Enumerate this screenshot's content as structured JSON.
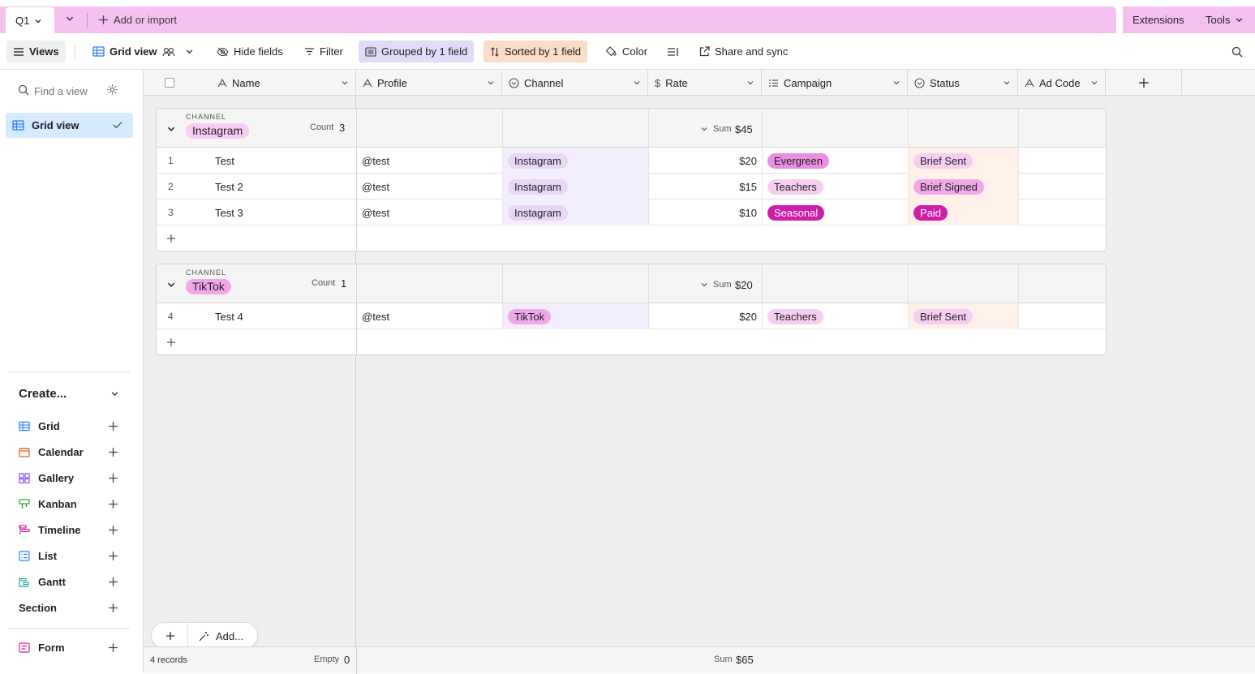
{
  "tabs": {
    "active": "Q1",
    "add_label": "Add or import",
    "extensions": "Extensions",
    "tools": "Tools"
  },
  "toolbar": {
    "views": "Views",
    "grid_view": "Grid view",
    "hide_fields": "Hide fields",
    "filter": "Filter",
    "grouped": "Grouped by 1 field",
    "sorted": "Sorted by 1 field",
    "color": "Color",
    "share": "Share and sync"
  },
  "sidebar": {
    "find_placeholder": "Find a view",
    "active_view": "Grid view",
    "create_label": "Create...",
    "items": [
      {
        "label": "Grid",
        "icon": "grid-icon",
        "color": "#2d7ff9"
      },
      {
        "label": "Calendar",
        "icon": "calendar-icon",
        "color": "#e0661a"
      },
      {
        "label": "Gallery",
        "icon": "gallery-icon",
        "color": "#8b46ff"
      },
      {
        "label": "Kanban",
        "icon": "kanban-icon",
        "color": "#20a53a"
      },
      {
        "label": "Timeline",
        "icon": "timeline-icon",
        "color": "#d6209e"
      },
      {
        "label": "List",
        "icon": "list-icon",
        "color": "#2d7ff9"
      },
      {
        "label": "Gantt",
        "icon": "gantt-icon",
        "color": "#13a89e"
      },
      {
        "label": "Section",
        "icon": "",
        "color": ""
      },
      {
        "label": "Form",
        "icon": "form-icon",
        "color": "#d6209e"
      }
    ]
  },
  "columns": [
    "Name",
    "Profile",
    "Channel",
    "Rate",
    "Campaign",
    "Status",
    "Ad Code"
  ],
  "groups": [
    {
      "field_label": "CHANNEL",
      "value": "Instagram",
      "count_label": "Count",
      "count": "3",
      "sum_label": "Sum",
      "sum": "$45",
      "rows": [
        {
          "num": "1",
          "name": "Test",
          "profile": "@test",
          "channel": "Instagram",
          "rate": "$20",
          "campaign": "Evergreen",
          "status": "Brief Sent"
        },
        {
          "num": "2",
          "name": "Test 2",
          "profile": "@test",
          "channel": "Instagram",
          "rate": "$15",
          "campaign": "Teachers",
          "status": "Brief Signed"
        },
        {
          "num": "3",
          "name": "Test 3",
          "profile": "@test",
          "channel": "Instagram",
          "rate": "$10",
          "campaign": "Seasonal",
          "status": "Paid"
        }
      ]
    },
    {
      "field_label": "CHANNEL",
      "value": "TikTok",
      "count_label": "Count",
      "count": "1",
      "sum_label": "Sum",
      "sum": "$20",
      "rows": [
        {
          "num": "4",
          "name": "Test 4",
          "profile": "@test",
          "channel": "TikTok",
          "rate": "$20",
          "campaign": "Teachers",
          "status": "Brief Sent"
        }
      ]
    }
  ],
  "footer": {
    "records": "4 records",
    "empty_label": "Empty",
    "empty_count": "0",
    "sum_label": "Sum",
    "sum": "$65",
    "add_label": "Add..."
  },
  "colors": {
    "accent_pink": "#f4c1ee",
    "grouped_bg": "#e1dbf7",
    "sorted_bg": "#fbdcc6",
    "status_col_bg": "#fff1ea",
    "channel_col_bg": "#f3eefd"
  }
}
